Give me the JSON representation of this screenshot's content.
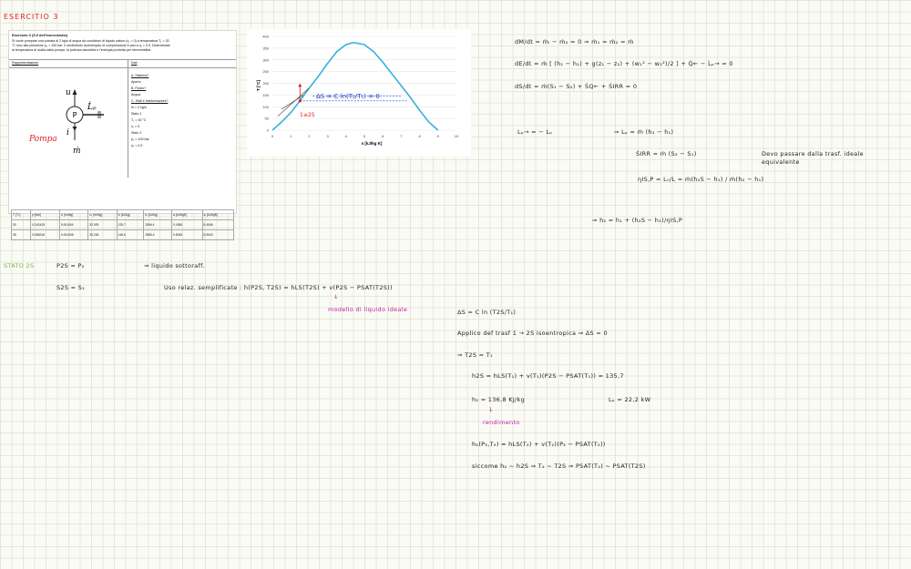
{
  "page": {
    "title": "ESERCITIO 3"
  },
  "exercise": {
    "title": "Esercizio 3 (5.9 dell'eserciziario)",
    "text_lines": [
      "Si vuole pompare una portata di 2 kg/s di acqua da condizioni di liquido saturo (x₁ = 0) a temperatura T₁ = 30",
      "°C sino alla pressione p₂ = 100 bar. Il rendimento isoentropico di compressione è pari a ηₛ = 0.9. Determinare",
      "la temperatura di uscita dalla pompa, la potenza assorbita e l'entropia prodotta per irreversibilità."
    ],
    "representation_label": "Rappresentazione",
    "data_label": "Dati",
    "diagram": {
      "pump_letter": "P",
      "pump_label": "Pompa",
      "out_label": "u",
      "in_label": "i",
      "power_label": "Ĺₚ",
      "flow_label": "ṁ"
    },
    "dati_lines": [
      {
        "text": "A. Sistema?",
        "underline": true
      },
      {
        "text": "Aperto",
        "underline": false
      },
      {
        "text": "B. Fluido?",
        "underline": true
      },
      {
        "text": "Acqua",
        "underline": false
      },
      {
        "text": "C. Stati e trasformazioni?",
        "underline": true
      },
      {
        "text": "ṁ = 2 kg/s",
        "underline": false
      },
      {
        "text": "Stato 1",
        "underline": false
      },
      {
        "text": "T₁ = 30 °C",
        "underline": false
      },
      {
        "text": "x₁ = 0",
        "underline": false
      },
      {
        "text": "Stato 2",
        "underline": false
      },
      {
        "text": "p₂ = 100 bar",
        "underline": false
      },
      {
        "text": "ηₛ = 0.9",
        "underline": false
      }
    ],
    "table": {
      "headers": [
        "T [°C]",
        "p [bar]",
        "vₗ [m³/kg]",
        "vᵥ [m³/kg]",
        "hₗ [kJ/kg]",
        "hᵥ [kJ/kg]",
        "sₗ [kJ/kgK]",
        "sᵥ [kJ/kgK]"
      ],
      "rows": [
        [
          "30",
          "0.042415",
          "0.001004",
          "32.929",
          "125.7",
          "2556.4",
          "0.4365",
          "8.4546"
        ],
        [
          "35",
          "0.056216",
          "0.001006",
          "25.246",
          "146.6",
          "2565.4",
          "0.5049",
          "8.3543"
        ]
      ]
    }
  },
  "chart_data": {
    "type": "line",
    "title": "",
    "xlabel": "s [kJ/kg K]",
    "ylabel": "T [°C]",
    "xlim": [
      0,
      10
    ],
    "ylim": [
      0,
      400
    ],
    "xticks": [
      0,
      1,
      2,
      3,
      4,
      5,
      6,
      7,
      8,
      9,
      10
    ],
    "yticks": [
      0,
      50,
      100,
      150,
      200,
      250,
      300,
      350,
      400
    ],
    "series": [
      {
        "x": [
          0,
          0.5,
          1,
          1.5,
          2,
          2.5,
          3,
          3.5,
          4,
          4.4,
          5,
          5.5,
          6,
          6.5,
          7,
          7.5,
          8,
          8.5,
          9
        ],
        "y": [
          0,
          35,
          75,
          125,
          180,
          230,
          285,
          335,
          365,
          374,
          365,
          335,
          290,
          240,
          190,
          140,
          85,
          35,
          0
        ]
      }
    ],
    "annotations": {
      "delta_s": "ΔS = C ln(T₂/T₁) = 0",
      "point": "1≡2S"
    }
  },
  "notes": {
    "eq1": "dM/dt = ṁᵢ − ṁ₂ = 0   ⇒  ṁ₁ = ṁ₂ = ṁ",
    "eq2": "dE/dt = ṁ [ (h₁ − h₂) + g(z₁ − z₂) + (w₁² − w₂²)/2 ] + Q̇← − L̇ₚ→ = 0",
    "eq3": "dS/dt = ṁ(S₁ − S₂) + ṠQ← + ṠIRR = 0",
    "eq4": "Lₚ→ = − Lₚ",
    "eq4b": "⇒     Lₚ = ṁ (h₂ − h₁)",
    "eq5": "ṠIRR = ṁ (S₂ − S₁)",
    "eq5_note_1": "Devo passare dalla trasf. ideale",
    "eq5_note_2": "equivalente",
    "eq6": "ηIS,P = L₀/L = ṁ(h₂S − h₁) / ṁ(h₂ − h₁)",
    "eq7": "⇒  h₂ = h₁ + (h₂S − h₁)/ηIS,P",
    "stato_label": "STATO 2S",
    "p2s": "P2S = P₂",
    "liquido": "⇒  liquido sottoraff.",
    "s2s": "S2S = S₁",
    "uso": "Uso relaz. semplificate :   h(P2S, T2S) = hLS(T2S) + v(P2S − PSAT(T2S))",
    "modello": "modello di liquido ideale",
    "delta_s": "ΔS = C ln (T2S/T₁)",
    "applico": "Applico def trasf  1 → 2S  isoentropica ⇒ ΔS = 0",
    "t2s": "⇒  T2S = T₁",
    "h2s": "h2S = hLS(T₁) + v(T₁)(P2S − PSAT(T₁)) = 135,7",
    "h2": "h₂ = 136,8  KJ/kg",
    "lp": "Lₚ = 22,2 kW",
    "rendimento": "rendimento",
    "h2_eq": "h₂(P₂,T₂) = hLS(T₂) + v(T₂)(P₂ − PSAT(T₂))",
    "siccome": "siccome  h₂ ~ h2S  ⇒  T₂ ~ T2S  ⇒  PSAT(T₂) ~ PSAT(T2S)"
  }
}
